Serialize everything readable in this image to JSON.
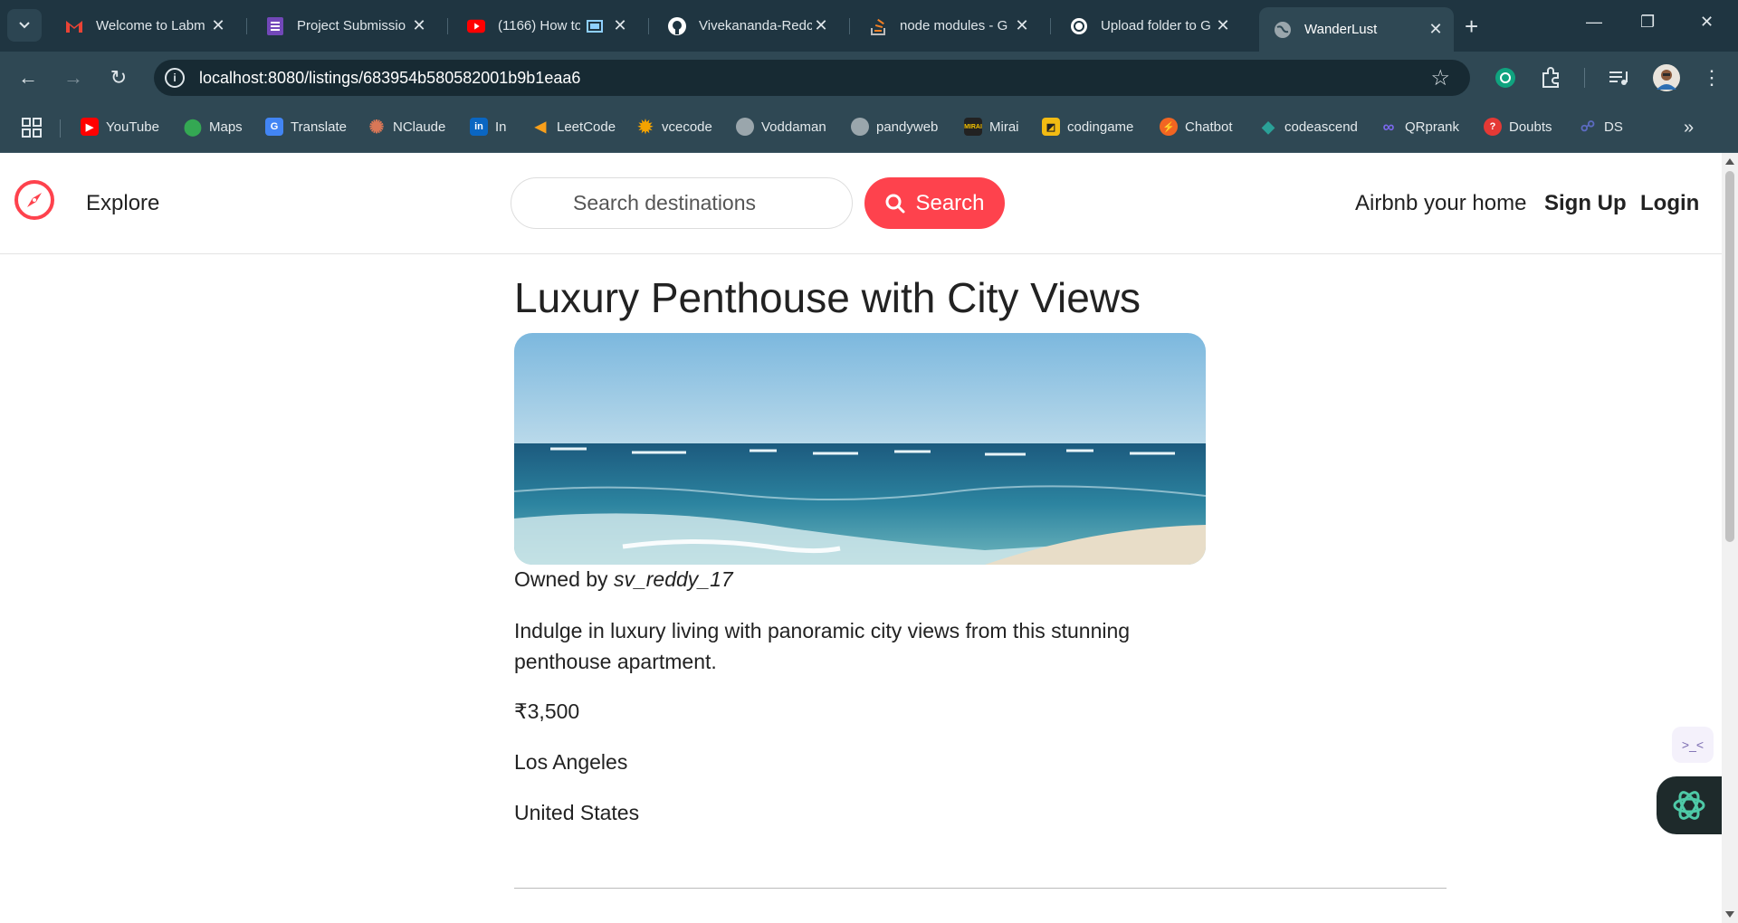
{
  "browser": {
    "tabs": [
      {
        "title": "Welcome to Labm",
        "icon": "gmail-icon",
        "active": false
      },
      {
        "title": "Project Submissio",
        "icon": "forms-icon",
        "active": false
      },
      {
        "title": "(1166) How to",
        "icon": "youtube-icon",
        "active": false
      },
      {
        "title": "Vivekananda-Redc",
        "icon": "github-icon",
        "active": false
      },
      {
        "title": "node modules - G",
        "icon": "stackoverflow-icon",
        "active": false
      },
      {
        "title": "Upload folder to G",
        "icon": "chatgpt-icon",
        "active": false
      },
      {
        "title": "WanderLust",
        "icon": "globe-icon",
        "active": true
      }
    ],
    "url": "localhost:8080/listings/683954b580582001b9b1eaa6",
    "bookmarks": [
      {
        "label": "YouTube",
        "icon": "youtube-icon",
        "color": "#ff0000"
      },
      {
        "label": "Maps",
        "icon": "maps-pin-icon",
        "color": "#34a853"
      },
      {
        "label": "Translate",
        "icon": "translate-icon",
        "color": "#4285f4"
      },
      {
        "label": "NClaude",
        "icon": "claude-icon",
        "color": "#d97757"
      },
      {
        "label": "In",
        "icon": "linkedin-icon",
        "color": "#0a66c2"
      },
      {
        "label": "LeetCode",
        "icon": "leetcode-icon",
        "color": "#f89f1b"
      },
      {
        "label": "vcecode",
        "icon": "sun-icon",
        "color": "#f4a300"
      },
      {
        "label": "Voddaman",
        "icon": "globe-icon",
        "color": "#9aa6ac"
      },
      {
        "label": "pandyweb",
        "icon": "globe-icon",
        "color": "#9aa6ac"
      },
      {
        "label": "Mirai",
        "icon": "mirai-icon",
        "color": "#222222"
      },
      {
        "label": "codingame",
        "icon": "codingame-icon",
        "color": "#f2bb13"
      },
      {
        "label": "Chatbot",
        "icon": "chatbot-icon",
        "color": "#f26522"
      },
      {
        "label": "codeascend",
        "icon": "diamond-icon",
        "color": "#2aa198"
      },
      {
        "label": "QRprank",
        "icon": "infinity-icon",
        "color": "#7b68ee"
      },
      {
        "label": "Doubts",
        "icon": "doubts-icon",
        "color": "#e53935"
      },
      {
        "label": "DS",
        "icon": "ds-icon",
        "color": "#5c6bc0"
      }
    ]
  },
  "navbar": {
    "explore": "Explore",
    "search_placeholder": "Search destinations",
    "search_button": "Search",
    "host_link": "Airbnb your home",
    "signup": "Sign Up",
    "login": "Login",
    "accent": "#fe424d"
  },
  "listing": {
    "title": "Luxury Penthouse with City Views",
    "owned_prefix": "Owned by",
    "owner": "sv_reddy_17",
    "description": "Indulge in luxury living with panoramic city views from this stunning penthouse apartment.",
    "price": "₹3,500",
    "location": "Los Angeles",
    "country": "United States"
  }
}
